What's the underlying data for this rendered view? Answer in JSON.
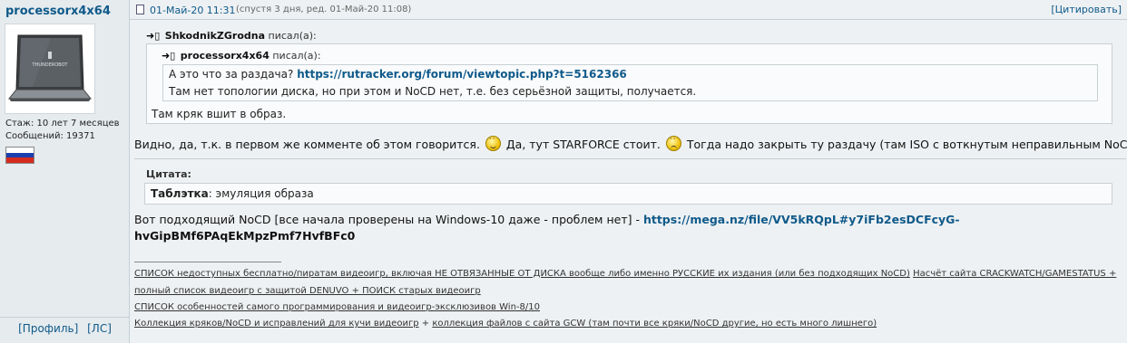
{
  "user": {
    "nickname": "processorx4x64",
    "tenure": "Стаж: 10 лет 7 месяцев",
    "messages": "Сообщений: 19371",
    "flag_colors": [
      "#ffffff",
      "#1c3fae",
      "#d52b1e"
    ],
    "profile_link": "[Профиль]",
    "pm_link": "[ЛС]",
    "avatar_brand": "THUNDEROBOT"
  },
  "post": {
    "date": "01-Май-20 11:31",
    "edited": "(спустя 3 дня, ред. 01-Май-20 11:08)",
    "quote_button": "[Цитировать]",
    "outer_quote": {
      "author": "ShkodnikZGrodna",
      "said": "писал(а):",
      "inner_quote": {
        "author": "processorx4x64",
        "said": "писал(а):",
        "line1_text": "А это что за раздача?",
        "line1_link": "https://rutracker.org/forum/viewtopic.php?t=5162366",
        "line2": "Там нет топологии диска, но при этом и NoCD нет, т.е. без серьёзной защиты, получается."
      },
      "reply": "Там кряк вшит в образ."
    },
    "reply_part1": "Видно, да, т.к. в первом же комменте об этом говорится.",
    "reply_part2": "Да, тут STARFORCE стоит.",
    "reply_part3": "Тогда надо закрыть ту раздачу (там ISO с воткнутым неправильным NoCD).",
    "cite_label": "Цитата:",
    "cite_bold": "Таблэтка",
    "cite_rest": ": эмуляция образа",
    "link_intro": "Вот подходящий NoCD [все начала проверены на Windows-10 даже - проблем нет] -",
    "link_part1": "https://mega.nz/file/VV5kRQpL#y7iFb2esDCFcyG-",
    "link_part2": "hvGipBMf6PAqEkMpzPmf7HvfBFc0"
  },
  "signature": {
    "line1_a": "СПИСОК недоступных бесплатно/пиратам видеоигр, включая НЕ ОТВЯЗАННЫЕ ОТ ДИСКА вообще либо именно РУССКИЕ их издания (или без подходящих NoCD)",
    "line1_b": "Насчёт сайта CRACKWATCH/GAMESTATUS +",
    "line2": "полный список видеоигр с защитой DENUVO + ПОИСК старых видеоигр",
    "line3": "СПИСОК особенностей самого программирования и видеоигр-эксклюзивов Win-8/10",
    "line4_a": "Коллекция кряков/NoCD и исправлений для кучи видеоигр",
    "line4_plus": "+",
    "line4_b": "коллекция файлов с сайта GCW (там почти все кряки/NoCD другие, но есть много лишнего)"
  }
}
